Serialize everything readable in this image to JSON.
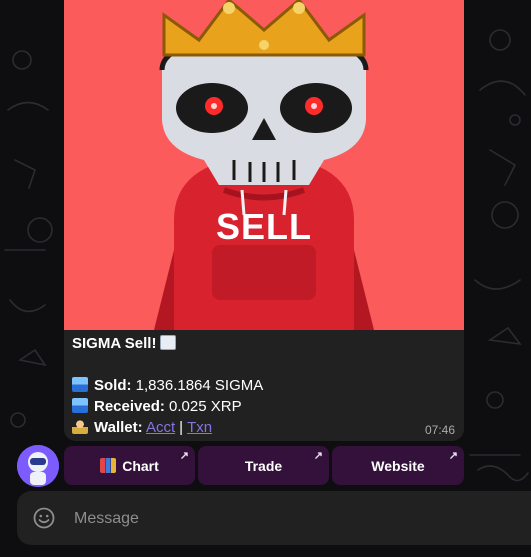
{
  "message": {
    "title": "SIGMA Sell!",
    "title_icon": "chart-decreasing",
    "photo_text": "SELL",
    "sold_label": "Sold:",
    "sold_value": "1,836.1864 SIGMA",
    "received_label": "Received:",
    "received_value": "0.025 XRP",
    "wallet_label": "Wallet:",
    "wallet_links": [
      "Acct",
      "Txn"
    ],
    "separator": "|",
    "time": "07:46"
  },
  "keyboard": {
    "buttons": [
      {
        "label": "Chart",
        "icon": "bar-chart-icon",
        "arrow": "↗"
      },
      {
        "label": "Trade",
        "arrow": "↗"
      },
      {
        "label": "Website",
        "arrow": "↗"
      }
    ]
  },
  "composer": {
    "placeholder": "Message"
  },
  "colors": {
    "photo_bg": "#fc5b5b",
    "hoodie": "#d8232f",
    "crown": "#e8a21b",
    "bubble": "#212121",
    "link": "#8774e1",
    "button_bg": "#33113a"
  }
}
